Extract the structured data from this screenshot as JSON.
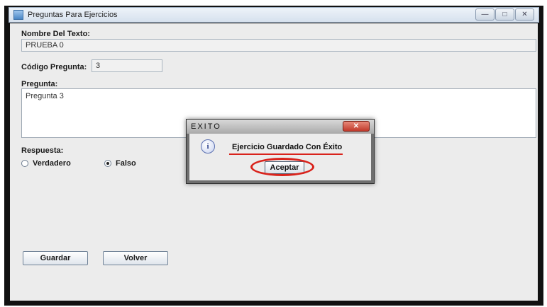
{
  "window": {
    "title": "Preguntas Para Ejercicios",
    "controls": [
      "—",
      "□",
      "✕"
    ]
  },
  "form": {
    "nombre_label": "Nombre Del Texto:",
    "nombre_value": "PRUEBA 0",
    "codigo_label": "Código Pregunta:",
    "codigo_value": "3",
    "pregunta_label": "Pregunta:",
    "pregunta_value": "Pregunta 3",
    "respuesta_label": "Respuesta:",
    "options": [
      {
        "label": "Verdadero",
        "selected": false
      },
      {
        "label": "Falso",
        "selected": true
      }
    ],
    "guardar_label": "Guardar",
    "volver_label": "Volver"
  },
  "dialog": {
    "title": "EXITO",
    "close": "✕",
    "icon": "info-icon",
    "icon_glyph": "i",
    "message": "Ejercicio Guardado Con Éxito",
    "ok_label": "Aceptar",
    "annotation_color": "#d9231c"
  }
}
